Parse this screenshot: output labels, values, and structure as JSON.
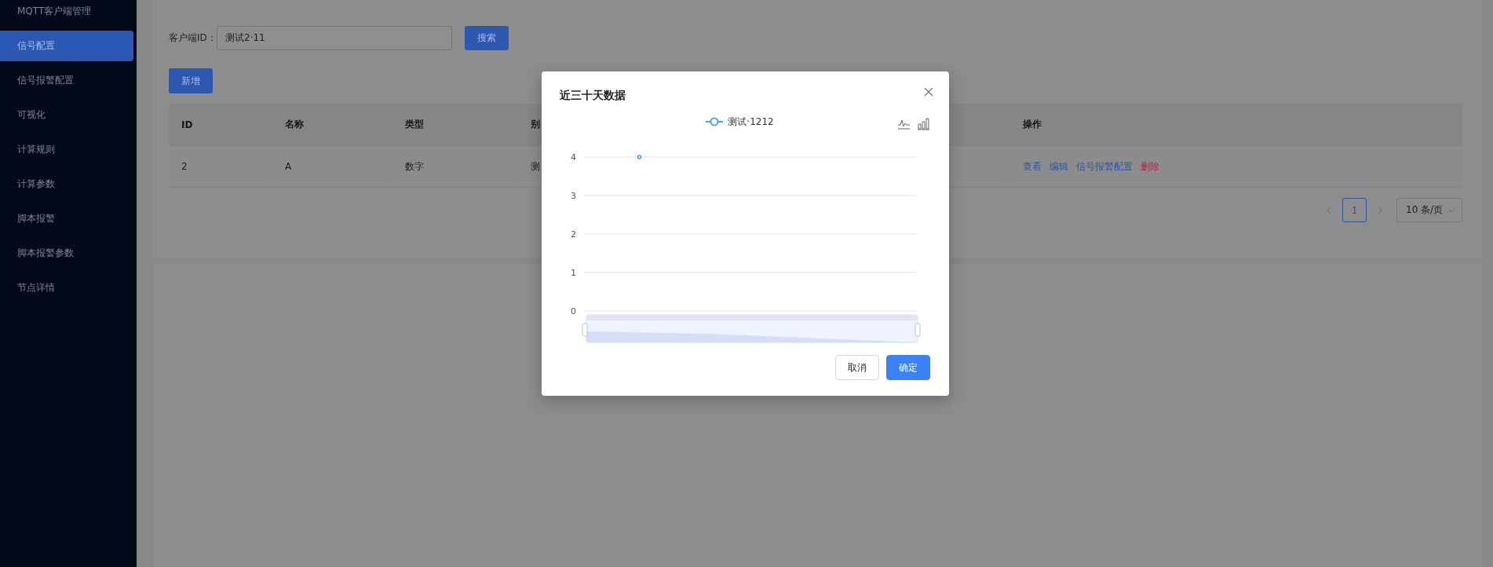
{
  "sidebar": {
    "title": "MQTT客户端管理",
    "items": [
      {
        "label": "信号配置",
        "selected": true
      },
      {
        "label": "信号报警配置",
        "selected": false
      },
      {
        "label": "可视化",
        "selected": false
      },
      {
        "label": "计算规则",
        "selected": false
      },
      {
        "label": "计算参数",
        "selected": false
      },
      {
        "label": "脚本报警",
        "selected": false
      },
      {
        "label": "脚本报警参数",
        "selected": false
      },
      {
        "label": "节点详情",
        "selected": false
      }
    ]
  },
  "search": {
    "label": "客户端ID：",
    "value": "测试2·11",
    "button": "搜索"
  },
  "add_button": "新增",
  "table": {
    "columns": [
      "ID",
      "名称",
      "类型",
      "别",
      "操作"
    ],
    "rows": [
      {
        "cells": [
          "2",
          "A",
          "数字",
          "测"
        ],
        "actions": [
          {
            "label": "查看",
            "kind": "link"
          },
          {
            "label": "编辑",
            "kind": "link"
          },
          {
            "label": "信号报警配置",
            "kind": "link"
          },
          {
            "label": "删除",
            "kind": "danger"
          }
        ]
      }
    ]
  },
  "pagination": {
    "pages": [
      {
        "label": "1",
        "selected": true
      }
    ],
    "page_size": "10 条/页"
  },
  "modal": {
    "title": "近三十天数据",
    "chart_data": {
      "type": "line",
      "grid": true,
      "series": [
        {
          "name": "测试·1212",
          "color": "#4aa8e0",
          "marker": true,
          "values": [
            4,
            null,
            null
          ]
        }
      ],
      "ylim": [
        0,
        4
      ],
      "yticks": [
        0,
        1,
        2,
        3,
        4
      ]
    },
    "buttons": [
      {
        "label": "取消",
        "kind": "default"
      },
      {
        "label": "确定",
        "kind": "primary"
      }
    ]
  }
}
